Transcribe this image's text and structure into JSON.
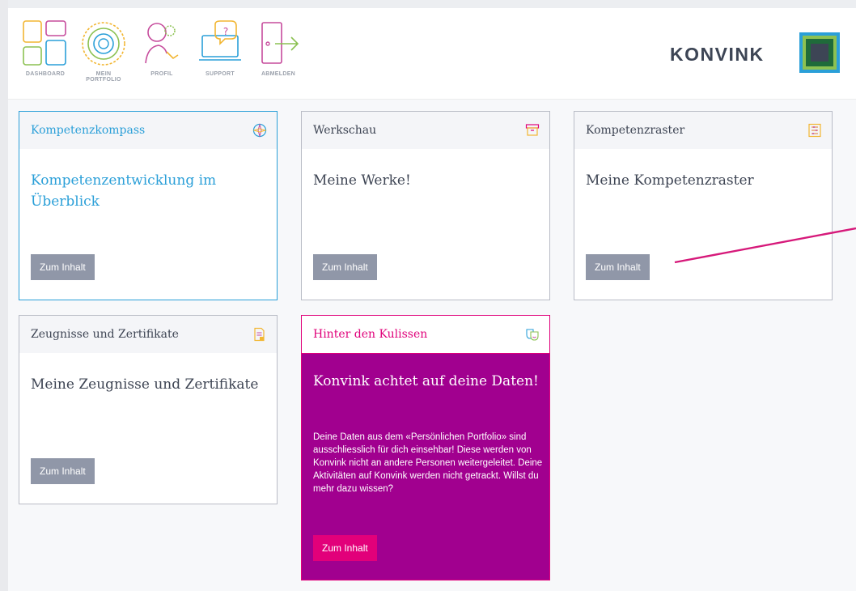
{
  "nav": {
    "items": [
      {
        "label": "DASHBOARD",
        "icon": "dashboard-icon"
      },
      {
        "label": "MEIN PORTFOLIO",
        "icon": "portfolio-icon"
      },
      {
        "label": "PROFIL",
        "icon": "profile-icon"
      },
      {
        "label": "SUPPORT",
        "icon": "support-icon"
      },
      {
        "label": "ABMELDEN",
        "icon": "logout-icon"
      }
    ]
  },
  "brand": {
    "name": "KONVINK",
    "mark": "konvink-logo-mark"
  },
  "colors": {
    "kompass_accent": "#2a9fd8",
    "kulissen_bg": "#a1008f",
    "kulissen_accent": "#e0007a",
    "button_gray": "#9097a8"
  },
  "cards": [
    {
      "header": "Kompetenzkompass",
      "icon": "compass-icon",
      "title": "Kompetenzentwicklung im Überblick",
      "button": "Zum Inhalt"
    },
    {
      "header": "Werkschau",
      "icon": "archive-box-icon",
      "title": "Meine Werke!",
      "button": "Zum Inhalt"
    },
    {
      "header": "Kompetenzraster",
      "icon": "grid-list-icon",
      "title": "Meine Kompetenzraster",
      "button": "Zum Inhalt"
    },
    {
      "header": "Zeugnisse und Zertifikate",
      "icon": "certificate-icon",
      "title": "Meine Zeugnisse und Zertifikate",
      "button": "Zum Inhalt"
    },
    {
      "header": "Hinter den Kulissen",
      "icon": "theater-masks-icon",
      "title": "Konvink achtet auf deine Daten!",
      "text": "Deine Daten aus dem «Persönlichen Portfolio» sind ausschliesslich für dich einsehbar! Diese werden von Konvink nicht an andere Personen weitergeleitet. Deine Aktivitäten auf Konvink werden nicht getrackt. Willst du mehr dazu wissen?",
      "button": "Zum Inhalt"
    }
  ]
}
